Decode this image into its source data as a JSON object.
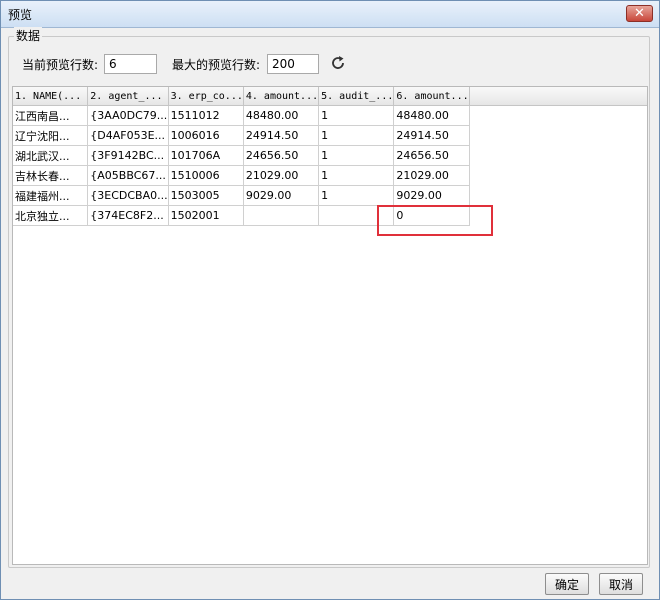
{
  "window": {
    "title": "预览"
  },
  "group": {
    "label": "数据"
  },
  "controls": {
    "current_rows_label": "当前预览行数:",
    "current_rows_value": "6",
    "max_rows_label": "最大的预览行数:",
    "max_rows_value": "200"
  },
  "table": {
    "columns": [
      "1. NAME(...",
      "2. agent_...",
      "3. erp_co...",
      "4. amount...",
      "5. audit_...",
      "6. amount..."
    ],
    "rows": [
      [
        "江西南昌...",
        "{3AA0DC79...",
        "1511012",
        "48480.00",
        "1",
        "48480.00"
      ],
      [
        "辽宁沈阳...",
        "{D4AF053E...",
        "1006016",
        "24914.50",
        "1",
        "24914.50"
      ],
      [
        "湖北武汉...",
        "{3F9142BC...",
        "101706A",
        "24656.50",
        "1",
        "24656.50"
      ],
      [
        "吉林长春...",
        "{A05BBC67...",
        "1510006",
        "21029.00",
        "1",
        "21029.00"
      ],
      [
        "福建福州...",
        "{3ECDCBA0...",
        "1503005",
        "9029.00",
        "1",
        "9029.00"
      ],
      [
        "北京独立...",
        "{374EC8F2...",
        "1502001",
        "",
        "",
        "0"
      ]
    ]
  },
  "buttons": {
    "ok": "确定",
    "cancel": "取消"
  },
  "icons": {
    "refresh": "refresh-icon",
    "close": "close-icon"
  },
  "colors": {
    "highlight": "#e0303a",
    "title_bar": "#d6e5f5"
  }
}
